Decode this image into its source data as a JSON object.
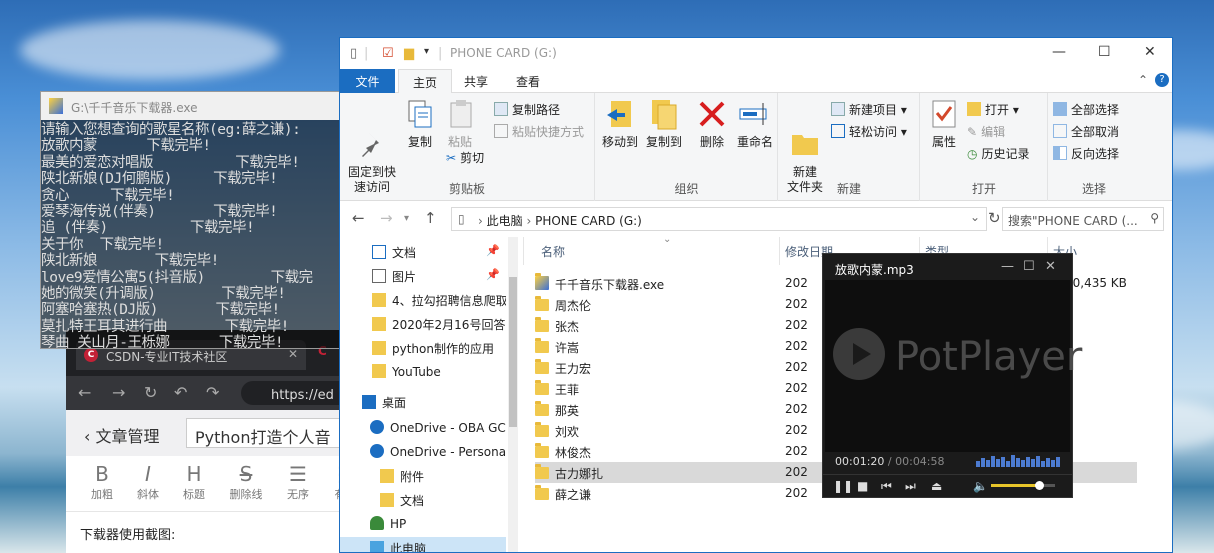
{
  "browser": {
    "tab_title": "CSDN-专业IT技术社区",
    "url": "https://ed",
    "header_back": "文章管理",
    "title_input": "Python打造个人音",
    "tools": [
      "加粗",
      "斜体",
      "标题",
      "删除线",
      "无序",
      "有"
    ],
    "body_text": "下载器使用截图:"
  },
  "console": {
    "title": "G:\\千千音乐下载器.exe",
    "lines": [
      "请输入您想查询的歌星名称(eg:薛之谦):",
      "放歌内蒙      下载完毕!",
      "最美的爱恋对唱版          下载完毕!",
      "陕北新娘(DJ何鹏版)     下载完毕!",
      "贪心     下载完毕!",
      "爱琴海传说(伴奏)       下载完毕!",
      "追 (伴奏)          下载完毕!",
      "关于你  下载完毕!",
      "陕北新娘       下载完毕!",
      "love9爱情公寓5(抖音版)        下载完",
      "她的微笑(升调版)        下载完毕!",
      "阿塞哈塞热(DJ版)       下载完毕!",
      "莫扎特王耳其进行曲       下载完毕!",
      "琴曲 关山月-王栎娜      下载完毕!"
    ]
  },
  "explorer": {
    "title": "PHONE CARD (G:)",
    "tabs": {
      "file": "文件",
      "home": "主页",
      "share": "共享",
      "view": "查看"
    },
    "ribbon": {
      "pin": "固定到快\n速访问",
      "copy": "复制",
      "paste": "粘贴",
      "copy_path": "复制路径",
      "paste_shortcut": "粘贴快捷方式",
      "cut": "剪切",
      "clipboard": "剪贴板",
      "move_to": "移动到",
      "copy_to": "复制到",
      "delete": "删除",
      "rename": "重命名",
      "organize": "组织",
      "new_folder": "新建\n文件夹",
      "new_item": "新建项目",
      "easy_access": "轻松访问",
      "new": "新建",
      "properties": "属性",
      "open": "打开",
      "edit": "编辑",
      "history": "历史记录",
      "open_group": "打开",
      "select_all": "全部选择",
      "select_none": "全部取消",
      "invert": "反向选择",
      "select_group": "选择"
    },
    "address": {
      "root": "此电脑",
      "current": "PHONE CARD (G:)"
    },
    "search_placeholder": "搜索\"PHONE CARD (...",
    "nav": [
      {
        "label": "文档",
        "pinned": true
      },
      {
        "label": "图片",
        "pinned": true
      },
      {
        "label": "4、拉勾招聘信息爬取"
      },
      {
        "label": "2020年2月16号回答问"
      },
      {
        "label": "python制作的应用"
      },
      {
        "label": "YouTube"
      },
      {
        "label": "桌面"
      },
      {
        "label": "OneDrive - OBA GC"
      },
      {
        "label": "OneDrive - Personal"
      },
      {
        "label": "附件"
      },
      {
        "label": "文档"
      },
      {
        "label": "HP"
      },
      {
        "label": "此电脑"
      }
    ],
    "columns": {
      "name": "名称",
      "date": "修改日期",
      "type": "类型",
      "size": "大小"
    },
    "files": [
      {
        "name": "千千音乐下载器.exe",
        "date": "202",
        "size": "10,435 KB",
        "exe": true
      },
      {
        "name": "周杰伦",
        "date": "202"
      },
      {
        "name": "张杰",
        "date": "202"
      },
      {
        "name": "许嵩",
        "date": "202"
      },
      {
        "name": "王力宏",
        "date": "202"
      },
      {
        "name": "王菲",
        "date": "202"
      },
      {
        "name": "那英",
        "date": "202"
      },
      {
        "name": "刘欢",
        "date": "202"
      },
      {
        "name": "林俊杰",
        "date": "202"
      },
      {
        "name": "古力娜扎",
        "date": "202",
        "selected": true
      },
      {
        "name": "薛之谦",
        "date": "202"
      }
    ]
  },
  "player": {
    "title": "放歌内蒙.mp3",
    "brand": "PotPlayer",
    "time_current": "00:01:20",
    "time_sep": " / ",
    "time_total": "00:04:58",
    "progress": 0.27,
    "volume": 0.75
  }
}
